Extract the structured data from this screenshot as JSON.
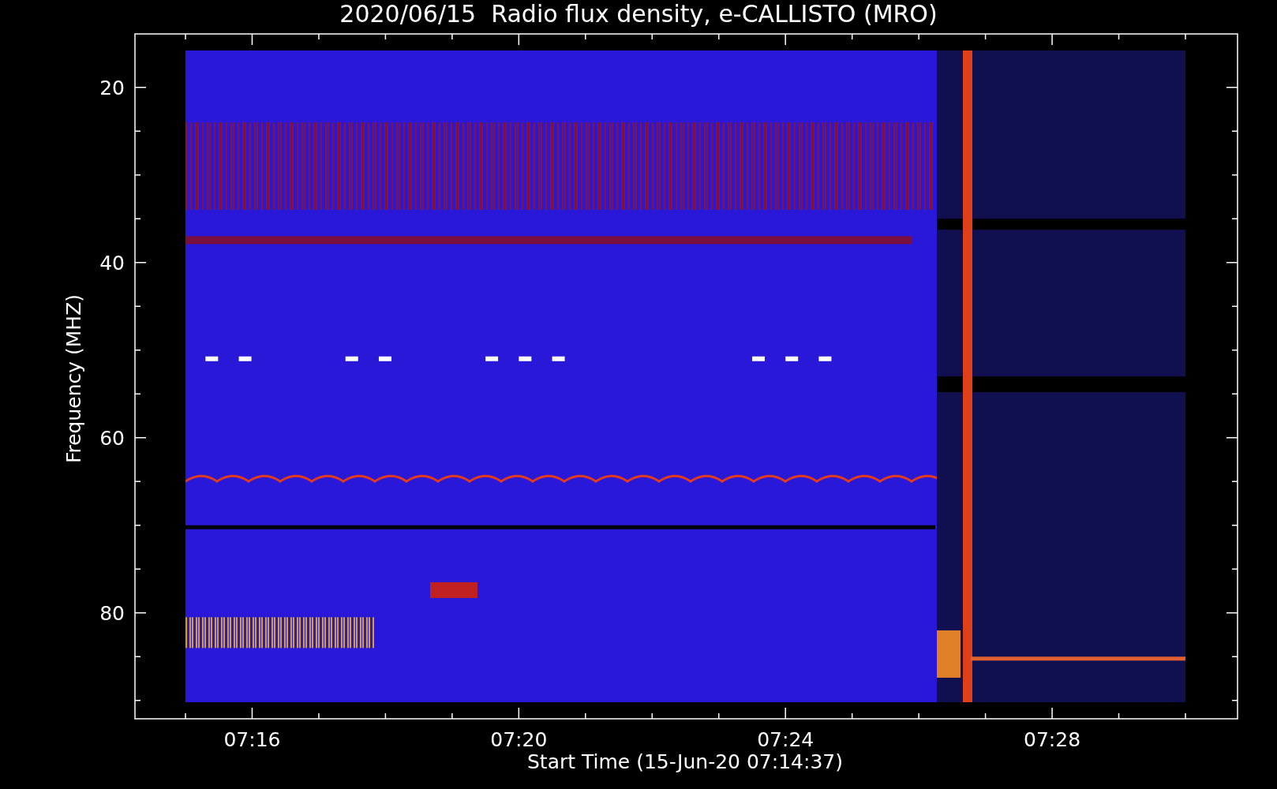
{
  "title": "2020/06/15  Radio flux density, e-CALLISTO (MRO)",
  "plot": {
    "ylabel": "Frequency (MHZ)",
    "xlabel": "Start Time (15-Jun-20 07:14:37)",
    "yticks": [
      "20",
      "40",
      "60",
      "80"
    ],
    "xticks": [
      "07:16",
      "07:20",
      "07:24",
      "07:28"
    ]
  }
}
